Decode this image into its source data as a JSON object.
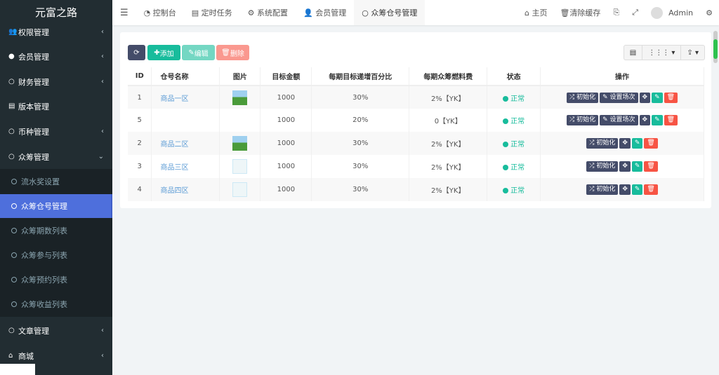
{
  "app_title": "元富之路",
  "sidebar": {
    "items": [
      {
        "label": "权限管理",
        "icon": "users-icon"
      },
      {
        "label": "会员管理",
        "icon": "user-circle-icon"
      },
      {
        "label": "财务管理",
        "icon": "circle-icon"
      },
      {
        "label": "版本管理",
        "icon": "file-icon"
      },
      {
        "label": "币种管理",
        "icon": "circle-icon"
      },
      {
        "label": "众筹管理",
        "icon": "circle-icon"
      },
      {
        "label": "文章管理",
        "icon": "circle-icon"
      },
      {
        "label": "商城",
        "icon": "home-icon"
      }
    ],
    "sub_items": [
      "流水奖设置",
      "众筹仓号管理",
      "众筹期数列表",
      "众筹参与列表",
      "众筹预约列表",
      "众筹收益列表"
    ],
    "active_sub": "众筹仓号管理"
  },
  "header": {
    "tabs": [
      {
        "label": "控制台",
        "icon": "dashboard-icon"
      },
      {
        "label": "定时任务",
        "icon": "tasks-icon"
      },
      {
        "label": "系统配置",
        "icon": "gear-icon"
      },
      {
        "label": "会员管理",
        "icon": "user-icon"
      },
      {
        "label": "众筹仓号管理",
        "icon": "circle-icon"
      }
    ],
    "home": "主页",
    "clear_cache": "清除缓存",
    "user": "Admin"
  },
  "toolbar": {
    "add": "添加",
    "edit": "编辑",
    "delete": "删除"
  },
  "table": {
    "columns": [
      "ID",
      "仓号名称",
      "图片",
      "目标金额",
      "每期目标递增百分比",
      "每期众筹燃料费",
      "状态",
      "操作"
    ],
    "rows": [
      {
        "id": "1",
        "name": "商品一区",
        "image": "tree",
        "amount": "1000",
        "pct": "30%",
        "fee": "2%【YK】",
        "status": "正常",
        "set_round": true
      },
      {
        "id": "5",
        "name": "",
        "image": "",
        "amount": "1000",
        "pct": "20%",
        "fee": "0【YK】",
        "status": "正常",
        "set_round": true
      },
      {
        "id": "2",
        "name": "商品二区",
        "image": "tree",
        "amount": "1000",
        "pct": "30%",
        "fee": "2%【YK】",
        "status": "正常",
        "set_round": false
      },
      {
        "id": "3",
        "name": "商品三区",
        "image": "bottle",
        "amount": "1000",
        "pct": "30%",
        "fee": "2%【YK】",
        "status": "正常",
        "set_round": false
      },
      {
        "id": "4",
        "name": "商品四区",
        "image": "bottle",
        "amount": "1000",
        "pct": "30%",
        "fee": "2%【YK】",
        "status": "正常",
        "set_round": false
      }
    ],
    "ops": {
      "init": "初始化",
      "set_round": "设置场次"
    }
  },
  "colors": {
    "sidebar": "#222d32",
    "active": "#4e6fdc",
    "success": "#18bc9c",
    "danger": "#f75444",
    "dark": "#444c69"
  }
}
